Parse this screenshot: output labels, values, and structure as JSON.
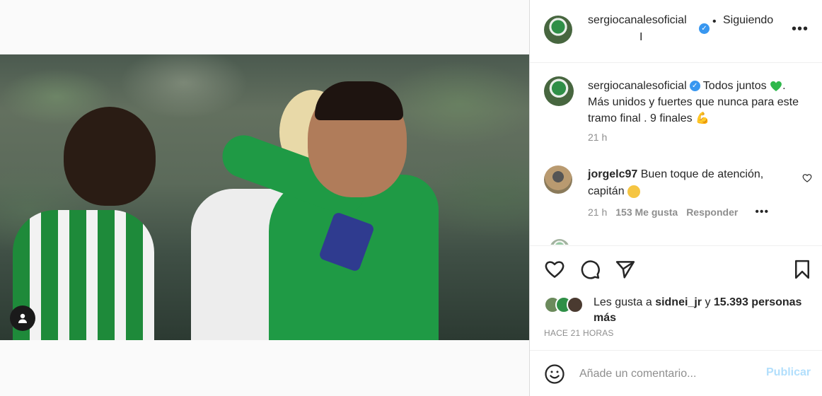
{
  "header": {
    "username": "sergiocanalesoficial",
    "separator": "•",
    "follow_status": "Siguiendo",
    "cursor": "I",
    "more": "•••"
  },
  "caption": {
    "username": "sergiocanalesoficial",
    "text_part1": "Todos juntos",
    "text_part2": ". Más unidos y fuertes que nunca para este tramo final . 9 finales",
    "time": "21 h"
  },
  "comments": [
    {
      "username": "jorgelc97",
      "text": "Buen toque de atención, capitán",
      "time": "21 h",
      "likes": "153 Me gusta",
      "reply": "Responder",
      "more": "•••"
    }
  ],
  "likes": {
    "prefix": "Les gusta a",
    "user": "sidnei_jr",
    "conjunction": "y",
    "others": "15.393 personas más"
  },
  "posted_ago": "HACE 21 HORAS",
  "add_comment": {
    "placeholder": "Añade un comentario...",
    "publish_label": "Publicar"
  },
  "colors": {
    "verified": "#3897f0",
    "publish_disabled": "#b2dffc",
    "muted": "#8e8e8e"
  }
}
